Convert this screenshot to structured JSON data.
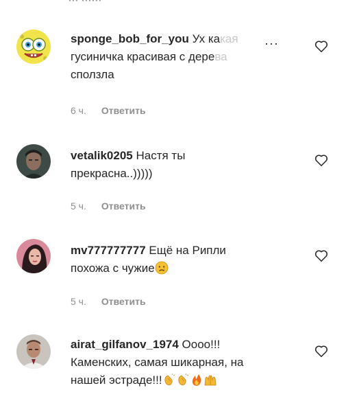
{
  "top_cut_text": "··· ······",
  "comments": [
    {
      "username": "sponge_bob_for_you",
      "text_lead": "Ух ка",
      "text_faded": "кая",
      "line2_lead": "гусиничка красивая с дере",
      "line2_faded": "ва",
      "line3": "сползла",
      "time": "6 ч.",
      "reply": "Ответить",
      "menu": "···"
    },
    {
      "username": "vetalik0205",
      "text": "Настя ты",
      "line2": "прекрасна..)))))",
      "time": "5 ч.",
      "reply": "Ответить"
    },
    {
      "username": "mv777777777",
      "text": "Ещё на Рипли",
      "line2": "похожа с чужие",
      "emoji_icons": [
        "crying-face-emoji"
      ],
      "time": "5 ч.",
      "reply": "Ответить"
    },
    {
      "username": "airat_gilfanov_1974",
      "text": "Оооо!!!",
      "line2": "Каменских, самая шикарная, на",
      "line3": "нашей эстраде!!!",
      "emoji_icons": [
        "clapping-hands-emoji",
        "clapping-hands-emoji",
        "fire-emoji",
        "raising-hands-emoji"
      ],
      "time": "5 ч.",
      "reply": "Ответить"
    }
  ],
  "icons": {
    "like": "heart-outline-icon",
    "options": "more-options-icon"
  }
}
